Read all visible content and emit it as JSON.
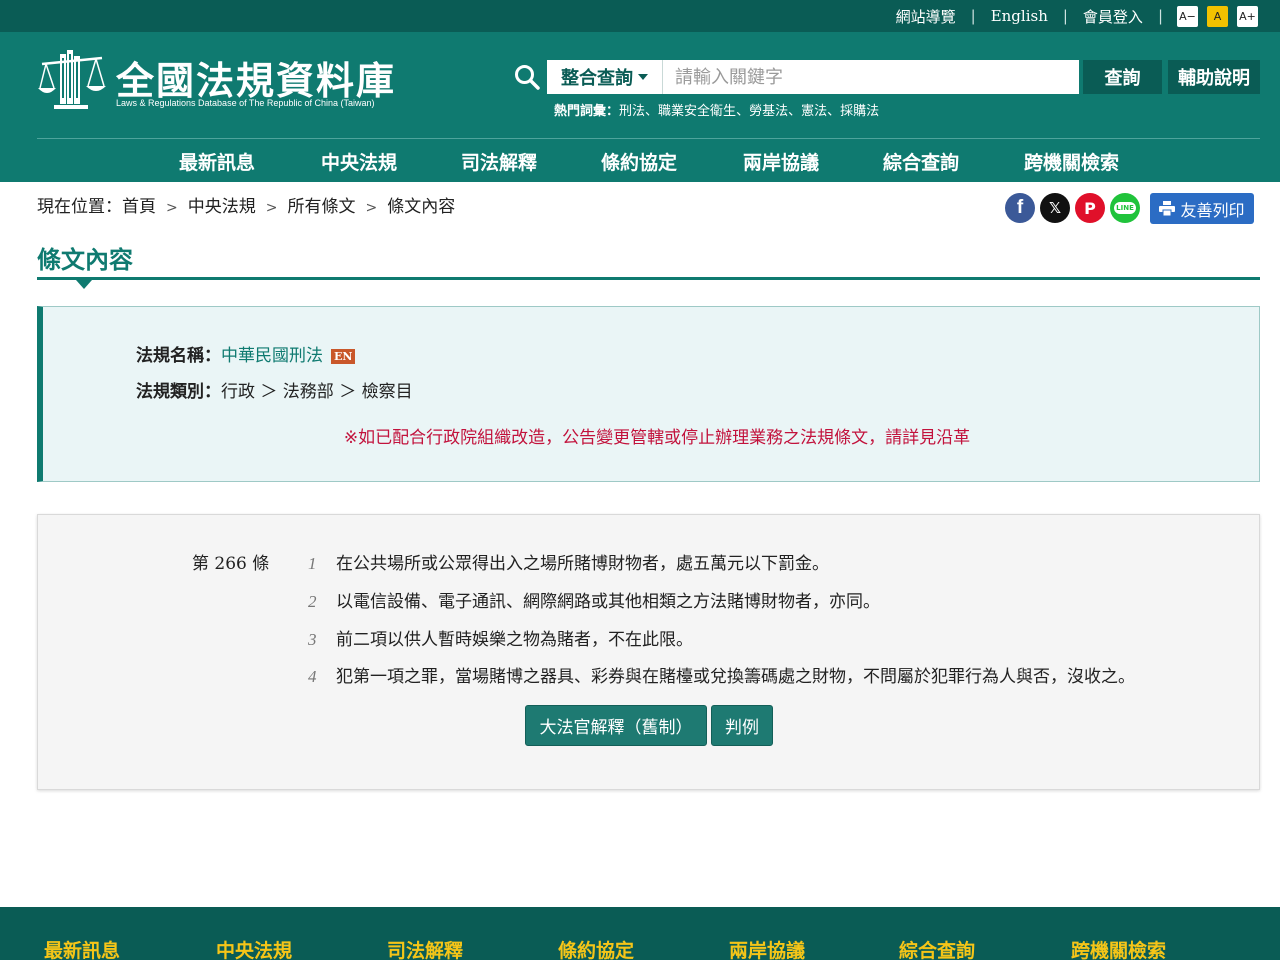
{
  "utility": {
    "sitemap": "網站導覽",
    "english": "English",
    "login": "會員登入",
    "separator": "|",
    "font_small": "A−",
    "font_medium": "A",
    "font_large": "A+"
  },
  "header": {
    "logo_title": "全國法規資料庫",
    "logo_subtitle": "Laws & Regulations Database of The Republic of China (Taiwan)",
    "search_scope": "整合查詢",
    "search_placeholder": "請輸入關鍵字",
    "search_value": "",
    "query_label": "查詢",
    "help_label": "輔助說明",
    "hot_label": "熱門詞彙：",
    "hot_terms": [
      "刑法",
      "職業安全衛生",
      "勞基法",
      "憲法",
      "採購法"
    ]
  },
  "nav": [
    "最新訊息",
    "中央法規",
    "司法解釋",
    "條約協定",
    "兩岸協議",
    "綜合查詢",
    "跨機關檢索"
  ],
  "breadcrumb": {
    "prefix": "現在位置：",
    "items": [
      "首頁",
      "中央法規",
      "所有條文",
      "條文內容"
    ],
    "arrow": ">"
  },
  "share": {
    "facebook": "f",
    "x": "𝕏",
    "plurk": "P",
    "line": "LINE",
    "print_label": "友善列印"
  },
  "page_title": "條文內容",
  "info": {
    "law_name_label": "法規名稱：",
    "law_name": "中華民國刑法",
    "en_badge": "EN",
    "category_label": "法規類別：",
    "category": "行政 ＞ 法務部 ＞ 檢察目",
    "notice": "※如已配合行政院組織改造，公告變更管轄或停止辦理業務之法規條文，請詳見沿革"
  },
  "article": {
    "number": "第 266 條",
    "paragraphs": [
      {
        "n": "1",
        "text": "在公共場所或公眾得出入之場所賭博財物者，處五萬元以下罰金。"
      },
      {
        "n": "2",
        "text": "以電信設備、電子通訊、網際網路或其他相類之方法賭博財物者，亦同。"
      },
      {
        "n": "3",
        "text": "前二項以供人暫時娛樂之物為賭者，不在此限。"
      },
      {
        "n": "4",
        "text": "犯第一項之罪，當場賭博之器具、彩券與在賭檯或兌換籌碼處之財物，不問屬於犯罪行為人與否，沒收之。"
      }
    ],
    "btn_interpretation": "大法官解釋（舊制）",
    "btn_judgment": "判例"
  },
  "footer": [
    "最新訊息",
    "中央法規",
    "司法解釋",
    "條約協定",
    "兩岸協議",
    "綜合查詢",
    "跨機關檢索"
  ],
  "colors": {
    "header_bg": "#0f7a70",
    "dark_bar": "#0a5c55",
    "notice_red": "#c2123c",
    "footer_text": "#f5c518",
    "print_btn": "#2b6cc4"
  }
}
